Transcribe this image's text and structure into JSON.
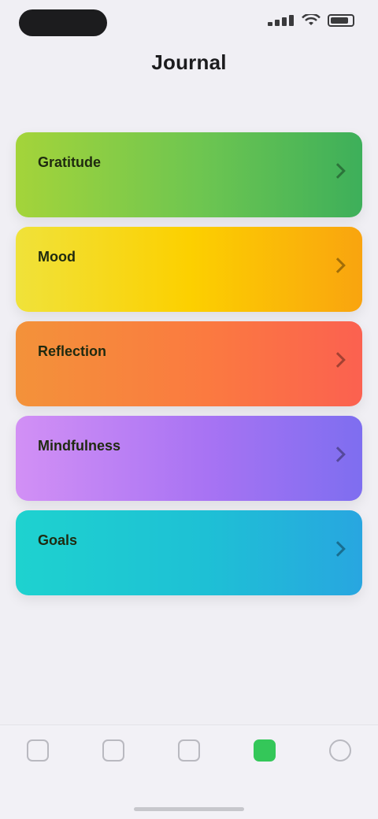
{
  "status_bar": {
    "icons": [
      "signal-icon",
      "wifi-icon",
      "battery-icon"
    ]
  },
  "header": {
    "title": "Journal",
    "subtitle": ""
  },
  "cards": [
    {
      "title": "Gratitude",
      "desc": "",
      "color": "#6cc551",
      "icon": "chevron-right-icon"
    },
    {
      "title": "Mood",
      "desc": "",
      "color": "#fcd000",
      "icon": "chevron-right-icon"
    },
    {
      "title": "Reflection",
      "desc": "",
      "color": "#fb7a40",
      "icon": "chevron-right-icon"
    },
    {
      "title": "Mindfulness",
      "desc": "",
      "color": "#a873f3",
      "icon": "chevron-right-icon"
    },
    {
      "title": "Goals",
      "desc": "",
      "color": "#1ec0d5",
      "icon": "chevron-right-icon"
    }
  ],
  "tab_bar": {
    "tabs": [
      {
        "label": "",
        "icon": "home-icon"
      },
      {
        "label": "",
        "icon": "list-icon"
      },
      {
        "label": "",
        "icon": "calendar-icon"
      },
      {
        "label": "",
        "icon": "journal-icon",
        "active": true
      },
      {
        "label": "",
        "icon": "profile-icon"
      }
    ],
    "accent": "#34c759"
  }
}
